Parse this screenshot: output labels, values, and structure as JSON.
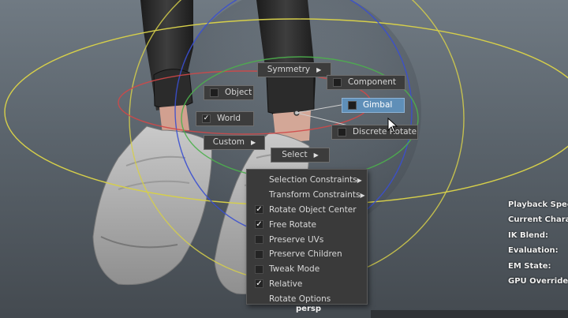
{
  "marking_menu": {
    "symmetry": "Symmetry",
    "object": "Object",
    "component": "Component",
    "world": "World",
    "gimbal": "Gimbal",
    "custom": "Custom",
    "discrete_rotate": "Discrete Rotate",
    "select": "Select"
  },
  "submenu": [
    {
      "label": "Selection Constraints",
      "kind": "submenu"
    },
    {
      "label": "Transform Constraints",
      "kind": "submenu"
    },
    {
      "label": "Rotate Object Center",
      "kind": "checkbox",
      "checked": true
    },
    {
      "label": "Free Rotate",
      "kind": "checkbox",
      "checked": true
    },
    {
      "label": "Preserve UVs",
      "kind": "checkbox",
      "checked": false
    },
    {
      "label": "Preserve Children",
      "kind": "checkbox",
      "checked": false
    },
    {
      "label": "Tweak Mode",
      "kind": "checkbox",
      "checked": false
    },
    {
      "label": "Relative",
      "kind": "checkbox",
      "checked": true
    },
    {
      "label": "Rotate Options",
      "kind": "command"
    }
  ],
  "hud": {
    "playback_speed": "Playback Speed",
    "current_character": "Current Charact",
    "ik_blend": "IK Blend:",
    "evaluation": "Evaluation:",
    "em_state": "EM State:",
    "gpu_override": "GPU Override:"
  },
  "viewport": {
    "camera": "persp"
  },
  "colors": {
    "highlight": "#5f8fb8",
    "menu_bg": "#3c3c3c",
    "gizmo_yellow": "#d6cf4a",
    "gizmo_red": "#d04848",
    "gizmo_blue": "#3a4fd0",
    "gizmo_green": "#4cb04c"
  }
}
